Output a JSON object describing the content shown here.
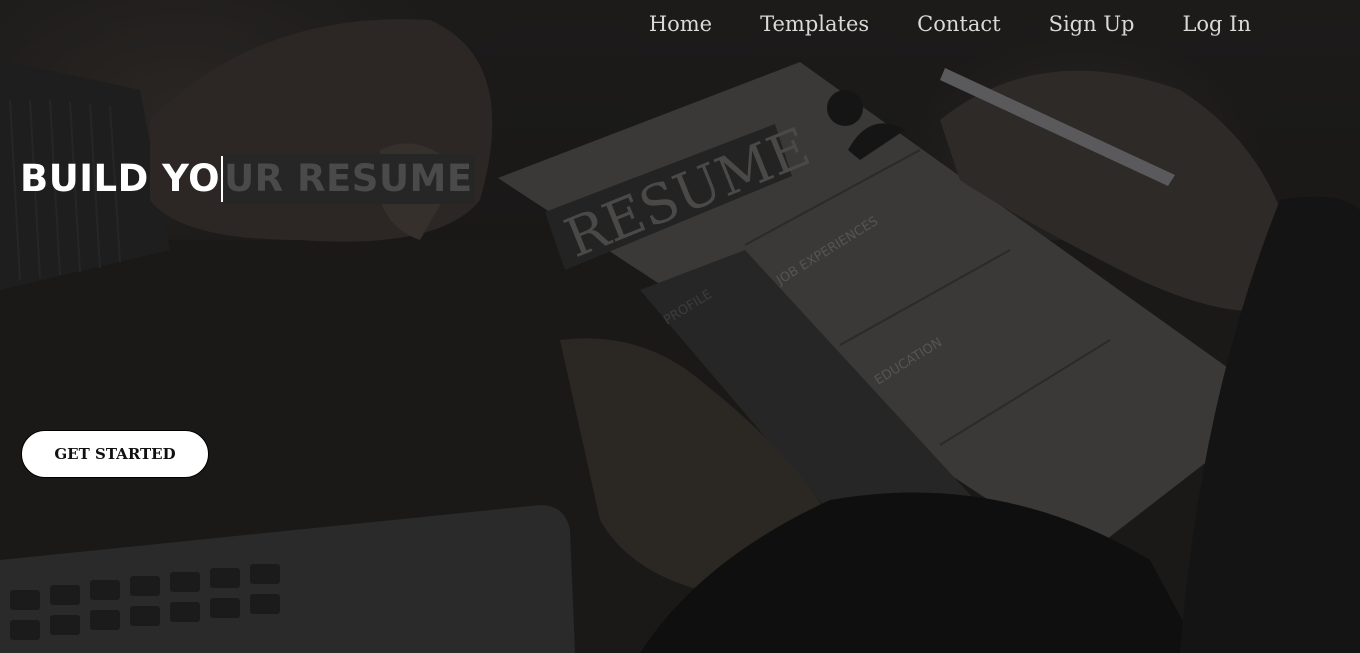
{
  "nav": {
    "items": [
      {
        "label": "Home"
      },
      {
        "label": "Templates"
      },
      {
        "label": "Contact"
      },
      {
        "label": "Sign Up"
      },
      {
        "label": "Log In"
      }
    ]
  },
  "hero": {
    "headline_typed": "BUILD YO",
    "headline_untyped": "UR RESUME",
    "cta_label": "GET STARTED",
    "photo_resume_text": "RESUME",
    "photo_section_labels": [
      "PROFILE",
      "JOB EXPERIENCES",
      "EDUCATION"
    ]
  },
  "colors": {
    "overlay": "#141414",
    "nav_text": "#d9d9d9",
    "headline": "#ffffff",
    "headline_dim": "#4a4a4a",
    "cta_bg": "#ffffff"
  }
}
